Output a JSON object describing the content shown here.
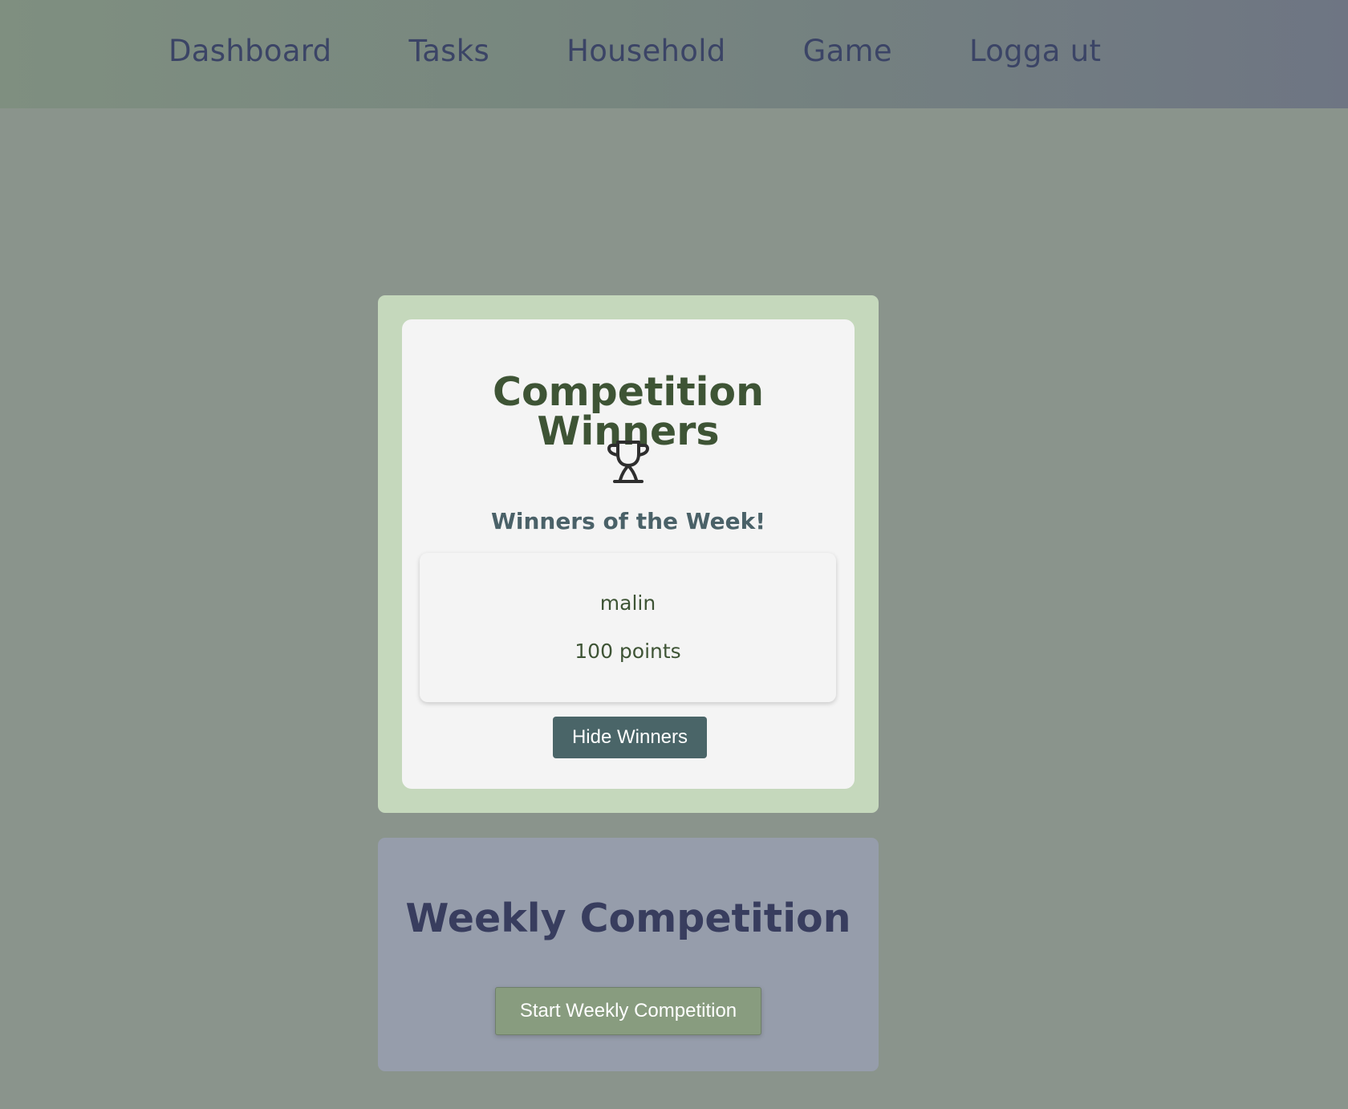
{
  "nav": {
    "items": [
      {
        "label": "Dashboard"
      },
      {
        "label": "Tasks"
      },
      {
        "label": "Household"
      },
      {
        "label": "Game"
      },
      {
        "label": "Logga ut"
      }
    ]
  },
  "winners_panel": {
    "title": "Competition Winners",
    "icon": "trophy-icon",
    "subtitle": "Winners of the Week!",
    "winners": [
      {
        "name": "malin",
        "points": "100 points"
      }
    ],
    "hide_button_label": "Hide Winners"
  },
  "weekly_panel": {
    "title": "Weekly Competition",
    "start_button_label": "Start Weekly Competition"
  },
  "colors": {
    "page_background": "#8a948c",
    "nav_text": "#3b4466",
    "winners_outer": "#c5d8bc",
    "card_background": "#f4f4f4",
    "title_green": "#3e5435",
    "hide_button": "#4a6568",
    "weekly_background": "#969dab",
    "weekly_title": "#383d5e",
    "start_button": "#889c7f"
  }
}
